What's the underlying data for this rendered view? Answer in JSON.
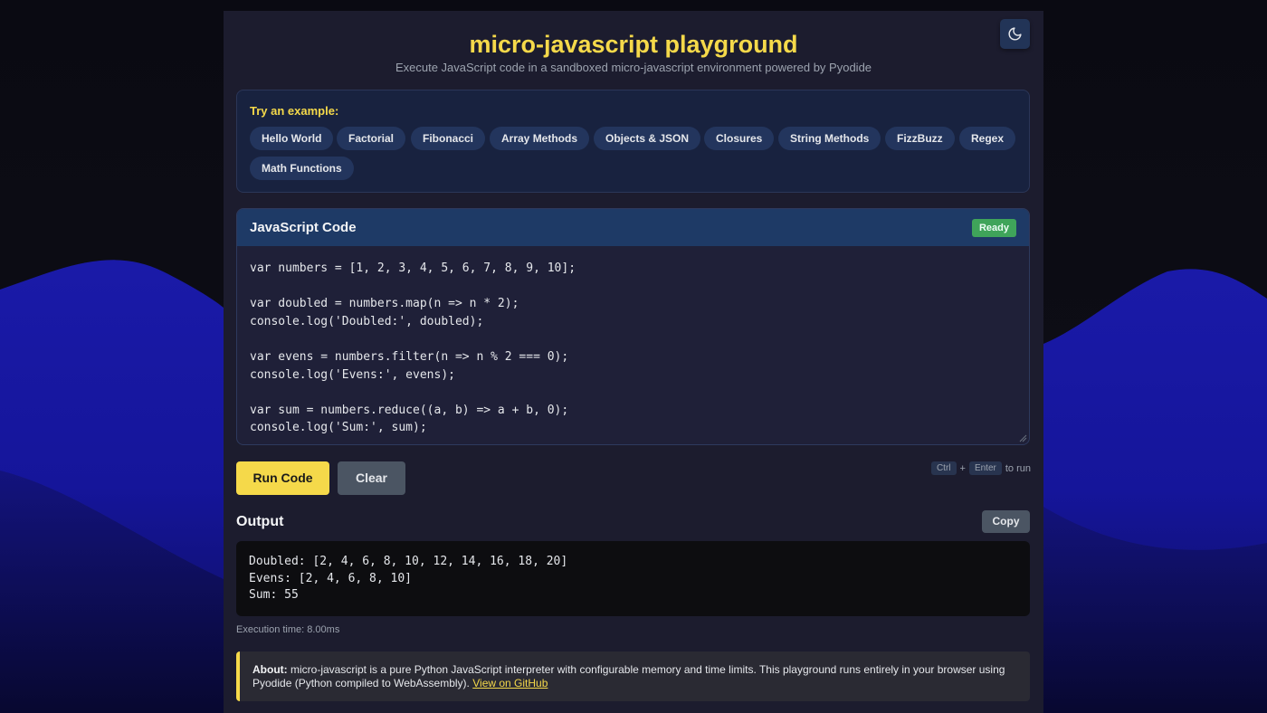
{
  "header": {
    "title": "micro-javascript playground",
    "subtitle": "Execute JavaScript code in a sandboxed micro-javascript environment powered by Pyodide",
    "theme_toggle_icon": "moon-icon"
  },
  "examples": {
    "label": "Try an example:",
    "items": [
      "Hello World",
      "Factorial",
      "Fibonacci",
      "Array Methods",
      "Objects & JSON",
      "Closures",
      "String Methods",
      "FizzBuzz",
      "Regex",
      "Math Functions"
    ]
  },
  "editor": {
    "title": "JavaScript Code",
    "status": "Ready",
    "code": "var numbers = [1, 2, 3, 4, 5, 6, 7, 8, 9, 10];\n\nvar doubled = numbers.map(n => n * 2);\nconsole.log('Doubled:', doubled);\n\nvar evens = numbers.filter(n => n % 2 === 0);\nconsole.log('Evens:', evens);\n\nvar sum = numbers.reduce((a, b) => a + b, 0);\nconsole.log('Sum:', sum);"
  },
  "actions": {
    "run_label": "Run Code",
    "clear_label": "Clear",
    "shortcut_key1": "Ctrl",
    "shortcut_plus": "+",
    "shortcut_key2": "Enter",
    "shortcut_suffix": "to run"
  },
  "output": {
    "title": "Output",
    "copy_label": "Copy",
    "text": "Doubled: [2, 4, 6, 8, 10, 12, 14, 16, 18, 20]\nEvens: [2, 4, 6, 8, 10]\nSum: 55",
    "execution_time": "Execution time: 8.00ms"
  },
  "about": {
    "label": "About:",
    "text": " micro-javascript is a pure Python JavaScript interpreter with configurable memory and time limits. This playground runs entirely in your browser using Pyodide (Python compiled to WebAssembly). ",
    "link_text": "View on GitHub"
  },
  "colors": {
    "accent": "#f5d94a",
    "status_ready": "#3fa45a",
    "panel": "#1c1c2e"
  }
}
